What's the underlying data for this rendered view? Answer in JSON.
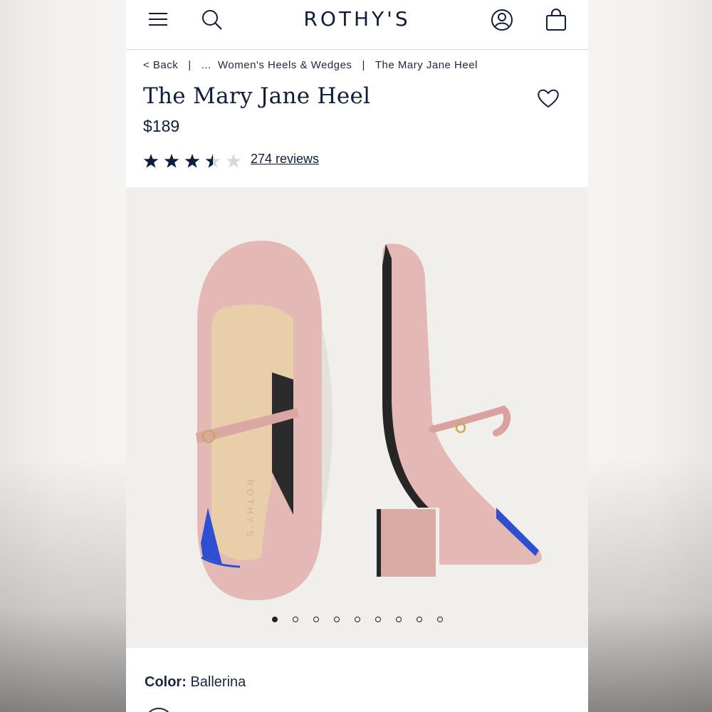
{
  "header": {
    "logo": "ROTHY'S",
    "icons": [
      "menu-icon",
      "search-icon",
      "account-icon",
      "bag-icon"
    ]
  },
  "breadcrumb": {
    "back": "< Back",
    "ellipsis": "...",
    "category": "Women's Heels & Wedges",
    "current": "The Mary Jane Heel"
  },
  "product": {
    "title": "The Mary Jane Heel",
    "price": "$189",
    "rating": 3.5,
    "rating_max": 5,
    "reviews": "274 reviews",
    "insole_brand": "ROTHY'S"
  },
  "gallery": {
    "slide_count": 9,
    "active_index": 0
  },
  "options": {
    "color_label": "Color:",
    "color_value": "Ballerina"
  },
  "colors": {
    "brand_navy": "#0f1d3d",
    "shoe_pink": "#e3b8b5",
    "insole_tan": "#e9cfa9",
    "accent_blue": "#2e4fd1"
  }
}
